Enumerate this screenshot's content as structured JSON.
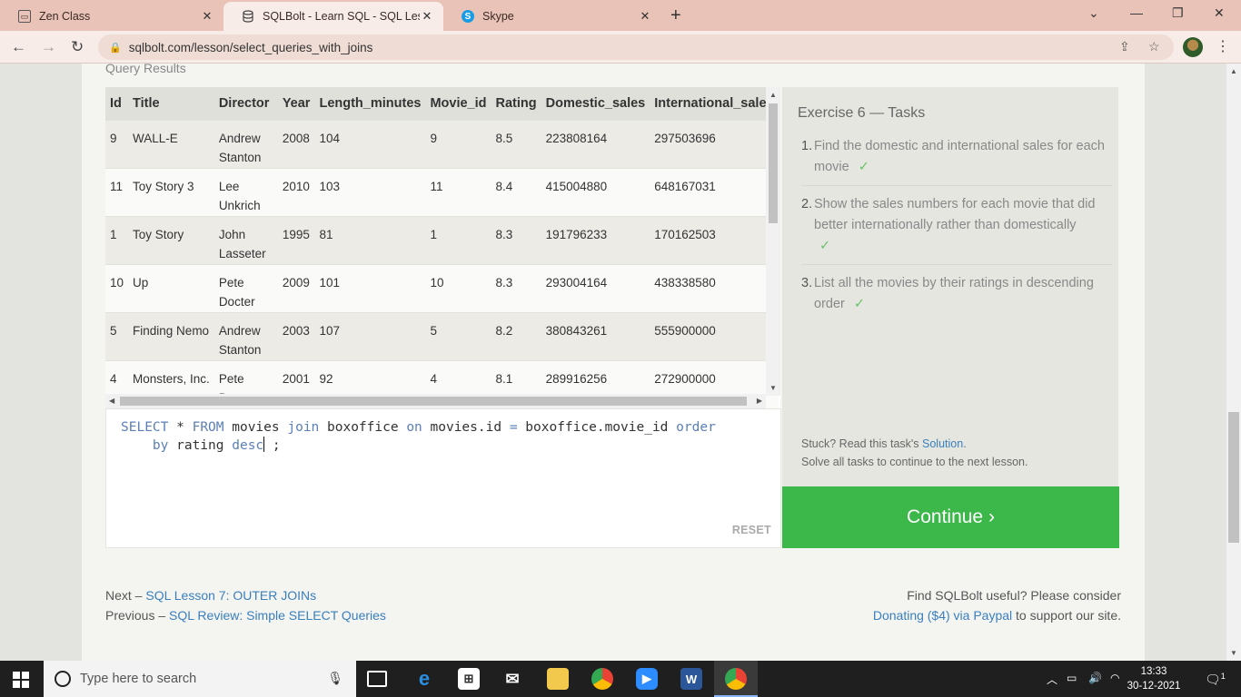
{
  "browser": {
    "tabs": [
      {
        "title": "Zen Class",
        "icon": "zen-class-favicon"
      },
      {
        "title": "SQLBolt - Learn SQL - SQL Lesson",
        "icon": "sqlbolt-favicon"
      },
      {
        "title": "Skype",
        "icon": "skype-favicon"
      }
    ],
    "url": "sqlbolt.com/lesson/select_queries_with_joins"
  },
  "query_results_label": "Query Results",
  "table": {
    "columns": [
      "Id",
      "Title",
      "Director",
      "Year",
      "Length_minutes",
      "Movie_id",
      "Rating",
      "Domestic_sales",
      "International_sales"
    ],
    "rows": [
      [
        "9",
        "WALL-E",
        "Andrew Stanton",
        "2008",
        "104",
        "9",
        "8.5",
        "223808164",
        "297503696"
      ],
      [
        "11",
        "Toy Story 3",
        "Lee Unkrich",
        "2010",
        "103",
        "11",
        "8.4",
        "415004880",
        "648167031"
      ],
      [
        "1",
        "Toy Story",
        "John Lasseter",
        "1995",
        "81",
        "1",
        "8.3",
        "191796233",
        "170162503"
      ],
      [
        "10",
        "Up",
        "Pete Docter",
        "2009",
        "101",
        "10",
        "8.3",
        "293004164",
        "438338580"
      ],
      [
        "5",
        "Finding Nemo",
        "Andrew Stanton",
        "2003",
        "107",
        "5",
        "8.2",
        "380843261",
        "555900000"
      ],
      [
        "4",
        "Monsters, Inc.",
        "Pete Docter",
        "2001",
        "92",
        "4",
        "8.1",
        "289916256",
        "272900000"
      ]
    ]
  },
  "editor": {
    "line1": [
      "SELECT",
      " * ",
      "FROM",
      " movies ",
      "join",
      " boxoffice ",
      "on",
      " movies.id ",
      "=",
      " boxoffice.movie_id ",
      "order"
    ],
    "line2": [
      "    ",
      "by",
      " rating ",
      "desc",
      " ;"
    ],
    "reset_label": "RESET"
  },
  "tasks": {
    "heading": "Exercise 6 — Tasks",
    "items": [
      {
        "num": "1.",
        "text": "Find the domestic and international sales for each movie",
        "check": "✓"
      },
      {
        "num": "2.",
        "text": "Show the sales numbers for each movie that did better internationally rather than domestically",
        "check": "✓"
      },
      {
        "num": "3.",
        "text": "List all the movies by their ratings in descending order",
        "check": "✓"
      }
    ],
    "stuck_text": "Stuck? Read this task's ",
    "solution_link": "Solution",
    "stuck_end": ".",
    "solve_all": "Solve all tasks to continue to the next lesson."
  },
  "continue_label": "Continue ›",
  "footer": {
    "next_prefix": "Next – ",
    "next_link": "SQL Lesson 7: OUTER JOINs",
    "prev_prefix": "Previous – ",
    "prev_link": "SQL Review: Simple SELECT Queries",
    "useful": "Find SQLBolt useful? Please consider",
    "donate_link": "Donating ($4) via Paypal",
    "donate_suffix": " to support our site."
  },
  "taskbar": {
    "search_placeholder": "Type here to search",
    "time": "13:33",
    "date": "30-12-2021",
    "notification_count": "1"
  },
  "colors": {
    "tab_bar": "#e9c3b7",
    "continue_button": "#3cb84a",
    "link": "#3a7fbd",
    "check": "#67c36a",
    "sql_keyword": "#5b7fb8"
  }
}
